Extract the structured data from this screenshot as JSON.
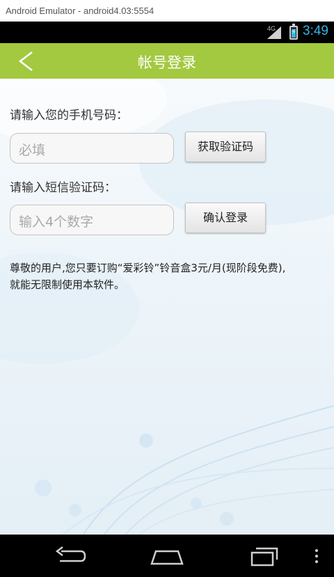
{
  "window": {
    "title": "Android Emulator - android4.03:5554"
  },
  "status_bar": {
    "network": "4G",
    "time": "3:49",
    "accent": "#33b5e5"
  },
  "app_bar": {
    "title": "帐号登录",
    "back_icon": "chevron-left-icon",
    "color": "#a3c940"
  },
  "form": {
    "phone_label": "请输入您的手机号码：",
    "phone_placeholder": "必填",
    "get_code_button": "获取验证码",
    "code_label": "请输入短信验证码：",
    "code_placeholder": "输入4个数字",
    "confirm_button": "确认登录"
  },
  "notice": {
    "line1": "尊敬的用户,您只要订购“爱彩铃”铃音盒3元/月(现阶段免费),",
    "line2": "就能无限制使用本软件。"
  },
  "nav_bar": {
    "buttons": [
      "back-icon",
      "home-icon",
      "recents-icon",
      "menu-icon"
    ]
  }
}
